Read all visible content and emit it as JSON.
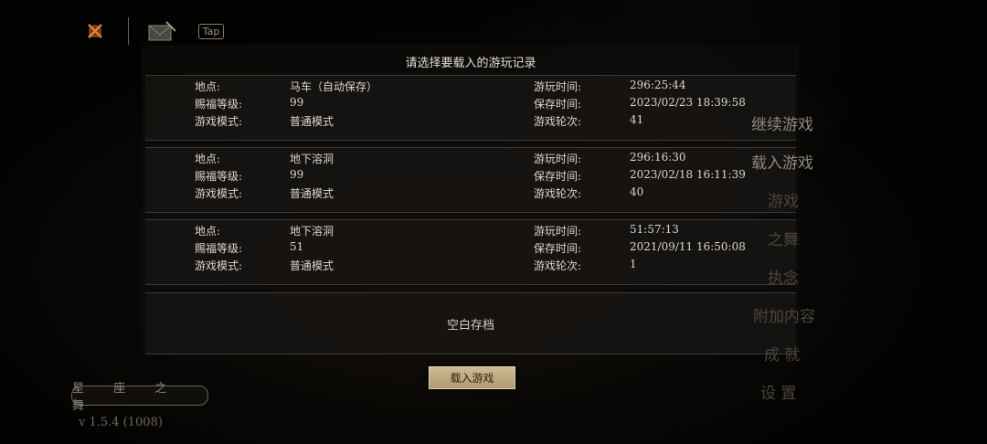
{
  "dialog": {
    "title": "请选择要载入的游玩记录",
    "labels": {
      "location": "地点:",
      "level": "赐福等级:",
      "mode": "游戏模式:",
      "playtime": "游玩时间:",
      "savetime": "保存时间:",
      "round": "游戏轮次:"
    },
    "saves": [
      {
        "location": "马车（自动保存）",
        "level": "99",
        "mode": "普通模式",
        "playtime": "296:25:44",
        "savetime": "2023/02/23 18:39:58",
        "round": "41"
      },
      {
        "location": "地下溶洞",
        "level": "99",
        "mode": "普通模式",
        "playtime": "296:16:30",
        "savetime": "2023/02/18 16:11:39",
        "round": "40"
      },
      {
        "location": "地下溶洞",
        "level": "51",
        "mode": "普通模式",
        "playtime": "51:57:13",
        "savetime": "2021/09/11 16:50:08",
        "round": "1"
      }
    ],
    "empty_slot": "空白存档",
    "load_button": "载入游戏"
  },
  "menu": {
    "items": [
      "继续游戏",
      "载入游戏",
      "游戏",
      "之舞",
      "执念",
      "附加内容",
      "成 就",
      "设 置"
    ]
  },
  "logo": "星 座 之 舞",
  "version": "v 1.5.4 (1008)",
  "top_bar": {
    "icons": [
      "bell-close-icon",
      "mail-icon",
      "tap-icon"
    ],
    "tap_label": "Tap"
  },
  "colors": {
    "accent": "#f07a2a",
    "button": "#c8b48c"
  }
}
